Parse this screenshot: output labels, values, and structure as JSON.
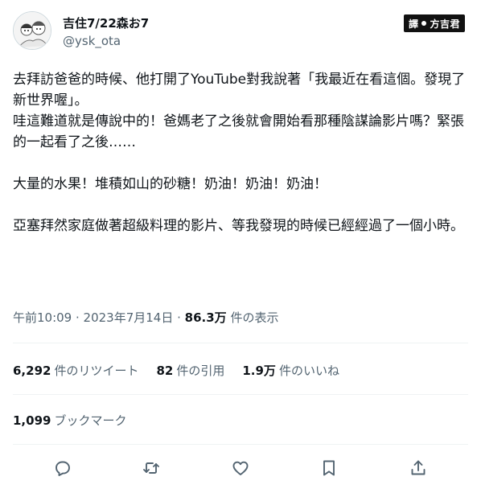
{
  "user": {
    "display_name": "吉住7/22森お7",
    "handle": "@ysk_ota"
  },
  "watermark": {
    "left": "譯",
    "right": "方吉君"
  },
  "tweet": {
    "lines": [
      "去拜訪爸爸的時候、他打開了YouTube對我說著「我最近在看這個。發現了新世界喔」。",
      "哇這難道就是傳說中的！爸媽老了之後就會開始看那種陰謀論影片嗎？緊張的一起看了之後……",
      "大量的水果！堆積如山的砂糖！奶油！奶油！奶油！",
      "亞塞拜然家庭做著超級料理的影片、等我發現的時候已經經過了一個小時。"
    ]
  },
  "meta": {
    "time": "午前10:09",
    "sep": " · ",
    "date": "2023年7月14日",
    "views_count": "86.3万",
    "views_label": "件の表示"
  },
  "stats": {
    "retweets_count": "6,292",
    "retweets_label": "件のリツイート",
    "quotes_count": "82",
    "quotes_label": "件の引用",
    "likes_count": "1.9万",
    "likes_label": "件のいいね"
  },
  "bookmarks": {
    "count": "1,099",
    "label": "ブックマーク"
  },
  "icons": {
    "reply": "reply-icon",
    "retweet": "retweet-icon",
    "like": "like-icon",
    "bookmark": "bookmark-icon",
    "share": "share-icon"
  },
  "colors": {
    "text": "#0f1419",
    "secondary": "#536471",
    "divider": "#eff3f4"
  }
}
